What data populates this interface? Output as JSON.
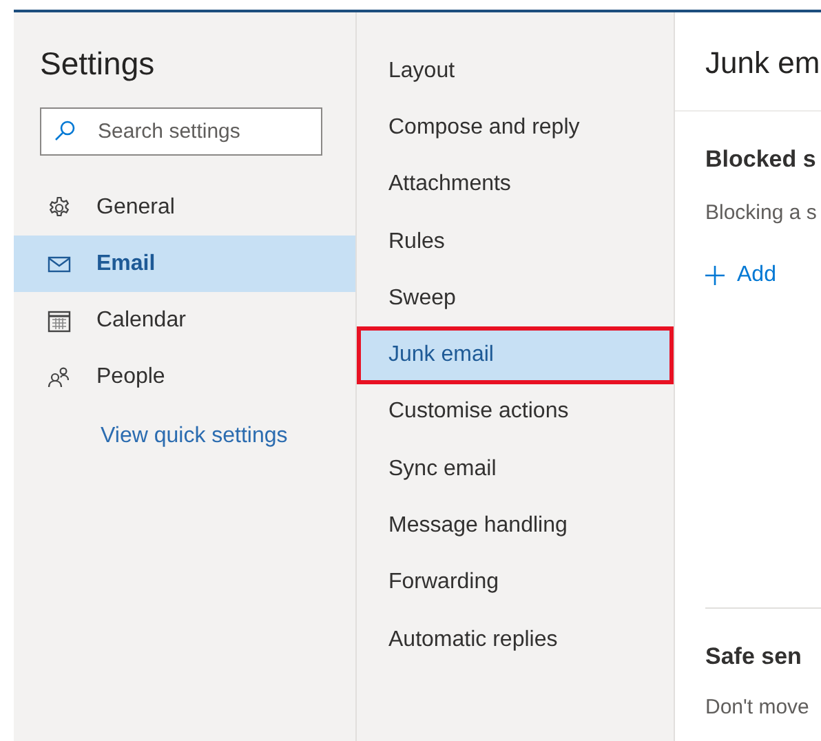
{
  "settings": {
    "title": "Settings",
    "search": {
      "placeholder": "Search settings"
    },
    "categories": [
      {
        "kind": "gear",
        "label": "General",
        "selected": false
      },
      {
        "kind": "mail",
        "label": "Email",
        "selected": true
      },
      {
        "kind": "calendar",
        "label": "Calendar",
        "selected": false
      },
      {
        "kind": "people",
        "label": "People",
        "selected": false
      }
    ],
    "quick_link": "View quick settings"
  },
  "email_sections": [
    {
      "label": "Layout",
      "selected": false,
      "highlighted": false
    },
    {
      "label": "Compose and reply",
      "selected": false,
      "highlighted": false
    },
    {
      "label": "Attachments",
      "selected": false,
      "highlighted": false
    },
    {
      "label": "Rules",
      "selected": false,
      "highlighted": false
    },
    {
      "label": "Sweep",
      "selected": false,
      "highlighted": false
    },
    {
      "label": "Junk email",
      "selected": true,
      "highlighted": true
    },
    {
      "label": "Customise actions",
      "selected": false,
      "highlighted": false
    },
    {
      "label": "Sync email",
      "selected": false,
      "highlighted": false
    },
    {
      "label": "Message handling",
      "selected": false,
      "highlighted": false
    },
    {
      "label": "Forwarding",
      "selected": false,
      "highlighted": false
    },
    {
      "label": "Automatic replies",
      "selected": false,
      "highlighted": false
    }
  ],
  "detail": {
    "title": "Junk em",
    "blocked_heading": "Blocked s",
    "blocked_text": "Blocking a s",
    "add_button": "Add",
    "safe_heading": "Safe sen",
    "safe_text": "Don't move"
  }
}
